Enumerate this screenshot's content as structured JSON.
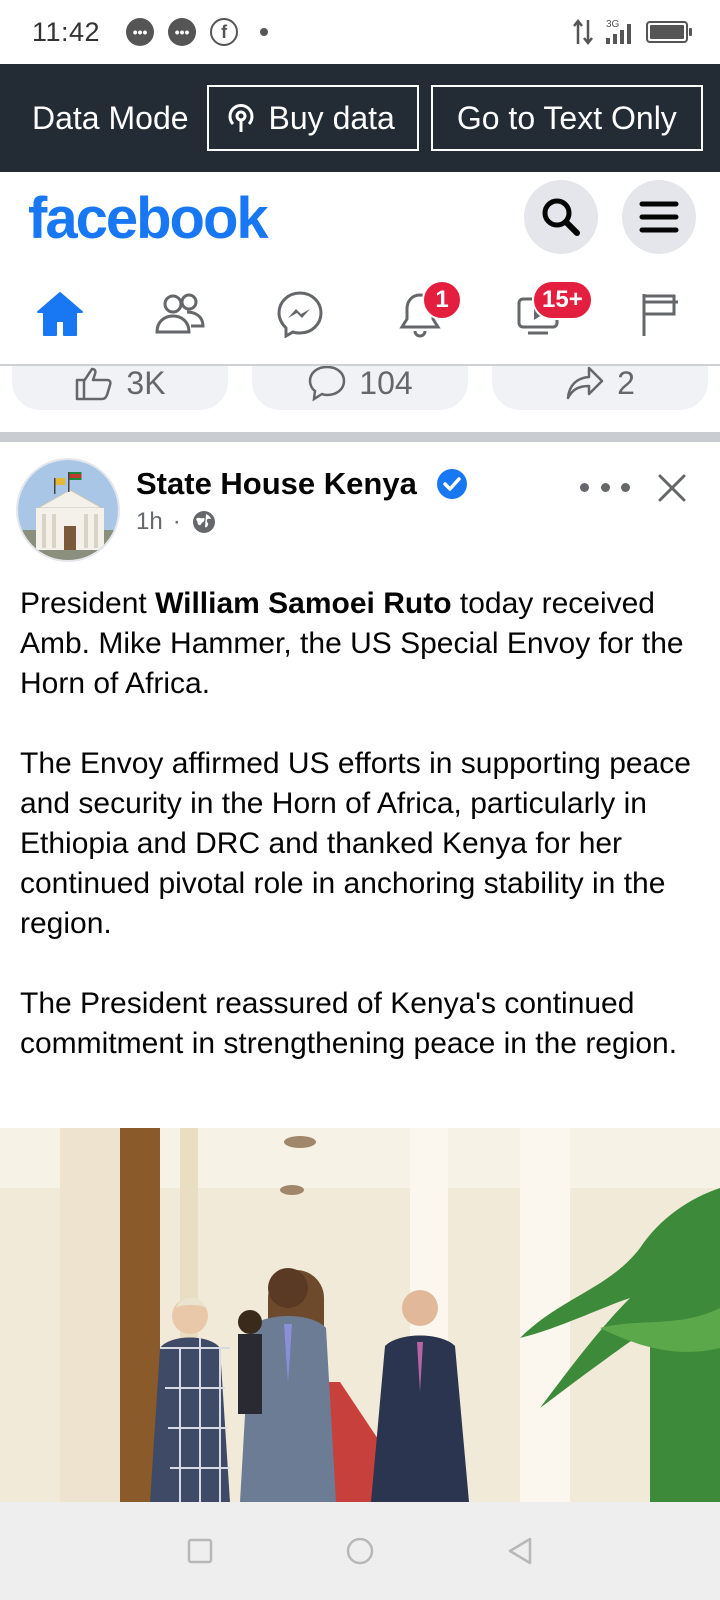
{
  "status_bar": {
    "time": "11:42",
    "network": "3G"
  },
  "data_mode": {
    "title": "Data Mode",
    "buy_label": "Buy data",
    "text_only_label": "Go to Text Only"
  },
  "header": {
    "logo": "facebook"
  },
  "nav": {
    "tabs": [
      {
        "name": "home",
        "icon": "home-icon",
        "active": true
      },
      {
        "name": "friends",
        "icon": "friends-icon"
      },
      {
        "name": "messenger",
        "icon": "messenger-icon"
      },
      {
        "name": "notifications",
        "icon": "bell-icon",
        "badge": "1"
      },
      {
        "name": "watch",
        "icon": "video-icon",
        "badge": "15+"
      },
      {
        "name": "pages",
        "icon": "flag-icon"
      }
    ]
  },
  "reactions": {
    "likes": "3K",
    "comments": "104",
    "shares": "2"
  },
  "post": {
    "page_name": "State House Kenya",
    "time": "1h",
    "separator": "·",
    "text_prefix": "President ",
    "text_bold": "William Samoei Ruto",
    "text_suffix": " today received Amb. Mike Hammer, the US Special Envoy for the Horn of Africa.",
    "paragraph_2": "The Envoy affirmed US efforts in supporting peace and security in the Horn of Africa, particularly in Ethiopia and DRC and thanked Kenya for her continued pivotal role in anchoring stability in the region.",
    "paragraph_3": "The President reassured of Kenya's continued commitment in strengthening peace in the region."
  },
  "colors": {
    "brand": "#1877f2",
    "badge": "#e41e3f",
    "data_bar": "#232b35"
  }
}
